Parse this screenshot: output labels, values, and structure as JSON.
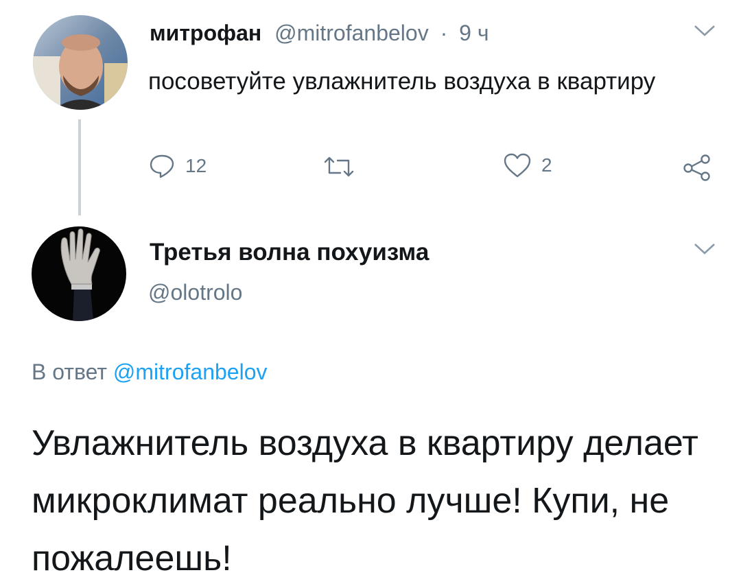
{
  "tweet1": {
    "name": "митрофан",
    "handle": "@mitrofanbelov",
    "separator": "·",
    "time": "9 ч",
    "text": "посоветуйте увлажнитель воздуха в квартиру",
    "reply_count": "12",
    "like_count": "2"
  },
  "tweet2": {
    "name": "Третья волна похуизма",
    "handle": "@olotrolo",
    "reply_prefix": "В ответ",
    "reply_mention": "@mitrofanbelov",
    "text": "Увлажнитель воздуха в квартиру делает микроклимат реально лучше! Купи, не пожалеешь!"
  },
  "colors": {
    "text_primary": "#14171a",
    "text_secondary": "#657786",
    "link": "#1da1f2",
    "thread_line": "#c9d2da"
  },
  "icons": {
    "reply": "reply-icon",
    "retweet": "retweet-icon",
    "like": "heart-icon",
    "share": "share-icon",
    "menu": "chevron-down-icon"
  }
}
